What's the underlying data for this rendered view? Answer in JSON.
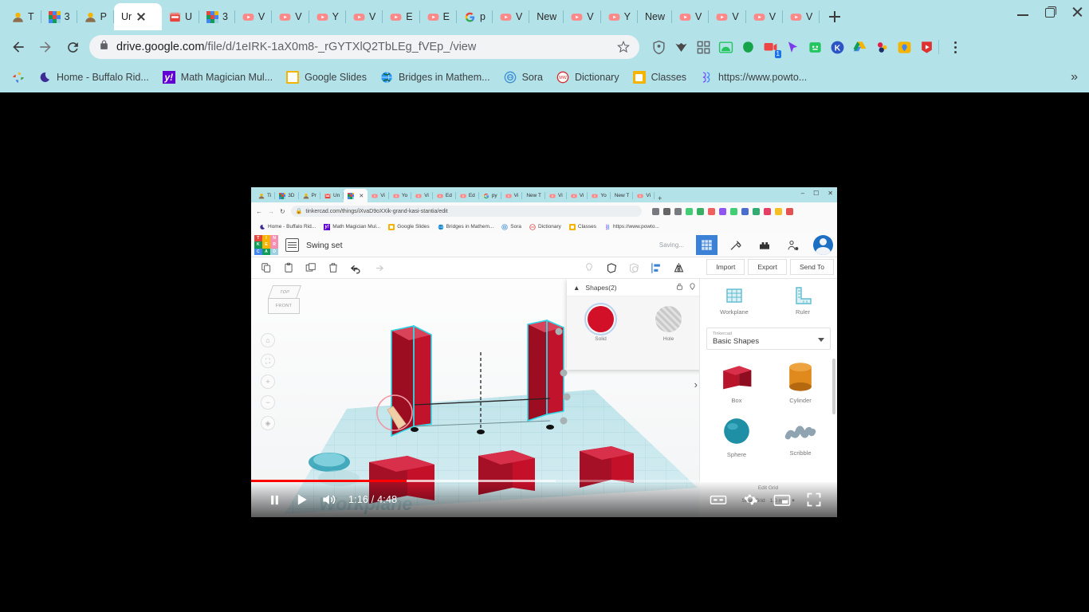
{
  "browser": {
    "tabs": [
      {
        "label": "T",
        "icon": "person-avatar-icon",
        "active": false
      },
      {
        "label": "3",
        "icon": "tinkercad-icon",
        "active": false
      },
      {
        "label": "P",
        "icon": "person-avatar-icon",
        "active": false
      },
      {
        "label": "Ur",
        "icon": "none",
        "active": true
      },
      {
        "label": "U",
        "icon": "film-icon",
        "active": false
      },
      {
        "label": "3",
        "icon": "tinkercad-icon",
        "active": false
      },
      {
        "label": "V",
        "icon": "youtube-icon",
        "active": false
      },
      {
        "label": "V",
        "icon": "youtube-icon",
        "active": false
      },
      {
        "label": "Y",
        "icon": "youtube-icon",
        "active": false
      },
      {
        "label": "V",
        "icon": "youtube-icon",
        "active": false
      },
      {
        "label": "E",
        "icon": "youtube-icon",
        "active": false
      },
      {
        "label": "E",
        "icon": "youtube-icon",
        "active": false
      },
      {
        "label": "p",
        "icon": "google-icon",
        "active": false
      },
      {
        "label": "V",
        "icon": "youtube-icon",
        "active": false
      },
      {
        "label": "New",
        "icon": "none",
        "active": false
      },
      {
        "label": "V",
        "icon": "youtube-icon",
        "active": false
      },
      {
        "label": "Y",
        "icon": "youtube-icon",
        "active": false
      },
      {
        "label": "New",
        "icon": "none",
        "active": false
      },
      {
        "label": "V",
        "icon": "youtube-icon",
        "active": false
      },
      {
        "label": "V",
        "icon": "youtube-icon",
        "active": false
      },
      {
        "label": "V",
        "icon": "youtube-icon",
        "active": false
      },
      {
        "label": "V",
        "icon": "youtube-icon",
        "active": false
      }
    ],
    "nav": {
      "back": "back-icon",
      "forward": "forward-icon",
      "reload": "reload-icon"
    },
    "omnibox": {
      "lock": "lock-icon",
      "domain": "drive.google.com",
      "path": "/file/d/1eIRK-1aX0m8-_rGYTXlQ2TbLEg_fVEp_/view",
      "star": "star-icon"
    },
    "extensions": [
      {
        "name": "shield-extension-icon",
        "color": "#5f6368"
      },
      {
        "name": "grammarly-extension-icon",
        "color": "#4a4a4a"
      },
      {
        "name": "apps-grid-icon",
        "color": "#5f6368"
      },
      {
        "name": "green-arch-extension-icon",
        "color": "#22c55e"
      },
      {
        "name": "green-blob-extension-icon",
        "color": "#16a34a"
      },
      {
        "name": "screencast-extension-icon",
        "color": "#ef4444",
        "badge": "1"
      },
      {
        "name": "cursor-extension-icon",
        "color": "#7c3aed"
      },
      {
        "name": "seesaw-extension-icon",
        "color": "#22c55e"
      },
      {
        "name": "kami-extension-icon",
        "color": "#2b54c6"
      },
      {
        "name": "google-drive-icon",
        "color": "#0f9d58"
      },
      {
        "name": "molecule-extension-icon",
        "color": "#e11d48"
      },
      {
        "name": "pin-map-extension-icon",
        "color": "#f4b400"
      },
      {
        "name": "video-record-extension-icon",
        "color": "#e03131"
      }
    ],
    "menu_icon": "kebab-menu-icon",
    "bookmarks": [
      {
        "label": "Home - Buffalo Rid...",
        "icon": "moon-icon"
      },
      {
        "label": "Math Magician Mul...",
        "icon": "yahoo-icon"
      },
      {
        "label": "Google Slides",
        "icon": "slides-icon"
      },
      {
        "label": "Bridges in Mathem...",
        "icon": "globe-icon"
      },
      {
        "label": "Sora",
        "icon": "sora-icon"
      },
      {
        "label": "Dictionary",
        "icon": "merriam-webster-icon"
      },
      {
        "label": "Classes",
        "icon": "classroom-icon"
      },
      {
        "label": "https://www.powto...",
        "icon": "powtoon-icon"
      }
    ],
    "bookmarks_photos_icon": "google-photos-icon",
    "bookmarks_overflow": "»",
    "window_controls": {
      "minimize": "minimize-icon",
      "maximize": "maximize-icon",
      "close": "close-icon"
    }
  },
  "player": {
    "current_time": "1:16",
    "duration": "4:48",
    "time_display": "1:16 / 4:48",
    "progress_percent": 26.5,
    "buffered_percent": 52,
    "pause_icon": "pause-icon",
    "play_icon": "play-icon",
    "volume_icon": "volume-icon",
    "cc_icon": "closed-captions-icon",
    "settings_icon": "settings-gear-icon",
    "miniplayer_icon": "miniplayer-icon",
    "fullscreen_icon": "fullscreen-icon"
  },
  "video": {
    "inner_browser": {
      "tabs": [
        {
          "label": "Ti",
          "icon": "person-avatar-icon",
          "active": false
        },
        {
          "label": "3D",
          "icon": "tinkercad-icon",
          "active": false
        },
        {
          "label": "Pr",
          "icon": "person-avatar-icon",
          "active": false
        },
        {
          "label": "Un",
          "icon": "film-icon",
          "active": false
        },
        {
          "label": "",
          "icon": "tinkercad-icon",
          "active": true
        },
        {
          "label": "Vi",
          "icon": "youtube-icon",
          "active": false
        },
        {
          "label": "Yo",
          "icon": "youtube-icon",
          "active": false
        },
        {
          "label": "Vi",
          "icon": "youtube-icon",
          "active": false
        },
        {
          "label": "Ed",
          "icon": "youtube-icon",
          "active": false
        },
        {
          "label": "Ed",
          "icon": "youtube-icon",
          "active": false
        },
        {
          "label": "py",
          "icon": "google-icon",
          "active": false
        },
        {
          "label": "Vi",
          "icon": "youtube-icon",
          "active": false
        },
        {
          "label": "New T",
          "icon": "none",
          "active": false
        },
        {
          "label": "Vi",
          "icon": "youtube-icon",
          "active": false
        },
        {
          "label": "Vi",
          "icon": "youtube-icon",
          "active": false
        },
        {
          "label": "Yo",
          "icon": "youtube-icon",
          "active": false
        },
        {
          "label": "New T",
          "icon": "none",
          "active": false
        },
        {
          "label": "Vi",
          "icon": "youtube-icon",
          "active": false
        }
      ],
      "url": "tinkercad.com/things/iXvaD9oXXik-grand-kasi-stantia/edit",
      "lock": "lock-icon",
      "bookmarks": [
        {
          "label": "Home - Buffalo Rid...",
          "icon": "moon-icon"
        },
        {
          "label": "Math Magician Mul...",
          "icon": "yahoo-icon"
        },
        {
          "label": "Google Slides",
          "icon": "slides-icon"
        },
        {
          "label": "Bridges in Mathem...",
          "icon": "globe-icon"
        },
        {
          "label": "Sora",
          "icon": "sora-icon"
        },
        {
          "label": "Dictionary",
          "icon": "merriam-webster-icon"
        },
        {
          "label": "Classes",
          "icon": "classroom-icon"
        },
        {
          "label": "https://www.powto...",
          "icon": "powtoon-icon"
        }
      ]
    },
    "tinkercad": {
      "logo_letters": [
        "T",
        "I",
        "N",
        "K",
        "E",
        "R",
        "C",
        "A",
        "D"
      ],
      "menu_icon": "hamburger-grid-icon",
      "project_name": "Swing set",
      "save_status": "Saving...",
      "mode_icons": [
        {
          "name": "3d-design-grid-icon",
          "active": true
        },
        {
          "name": "codeblocks-hammer-icon",
          "active": false
        },
        {
          "name": "blocks-icon",
          "active": false
        },
        {
          "name": "invite-person-icon",
          "active": false
        }
      ],
      "avatar": "user-avatar",
      "toolbar_icons": [
        "copy-icon",
        "paste-icon",
        "duplicate-icon",
        "delete-icon",
        "undo-icon",
        "redo-icon",
        "light-bulb-icon",
        "group-icon",
        "ungroup-icon",
        "align-icon",
        "mirror-icon"
      ],
      "buttons": [
        "Import",
        "Export",
        "Send To"
      ],
      "viewcube": {
        "top": "TOP",
        "front": "FRONT"
      },
      "nav_buttons": [
        "home-view-icon",
        "fit-view-icon",
        "zoom-in-icon",
        "zoom-out-icon",
        "perspective-icon"
      ],
      "shapes_panel": {
        "title": "Shapes(2)",
        "collapse_icon": "collapse-caret-icon",
        "lock_icon": "unlock-icon",
        "drop_icon": "pin-icon",
        "options": [
          {
            "label": "Solid",
            "swatch": "solid-red"
          },
          {
            "label": "Hole",
            "swatch": "hole-hatched"
          }
        ]
      },
      "side_panel": {
        "workplane_label": "Workplane",
        "ruler_label": "Ruler",
        "library_brand": "Tinkercad",
        "library_name": "Basic Shapes",
        "shapes": [
          {
            "label": "Box",
            "color": "#b8152b"
          },
          {
            "label": "Cylinder",
            "color": "#e08a1e"
          },
          {
            "label": "Sphere",
            "color": "#1f8fa6"
          },
          {
            "label": "Scribble",
            "color": "#8fa3b0"
          }
        ]
      },
      "grid_bar": {
        "edit_grid": "Edit Grid",
        "snap_grid_label": "Snap Grid",
        "snap_grid_value": "1.0 mm"
      },
      "workplane_watermark": "Workplane"
    }
  },
  "colors": {
    "chrome_tabstrip": "#b3e2e8",
    "youtube_red": "#ff0000",
    "tinkercad_blue": "#3b82d6",
    "shape_red": "#c5102a",
    "workplane_cyan": "#a8dce4"
  }
}
